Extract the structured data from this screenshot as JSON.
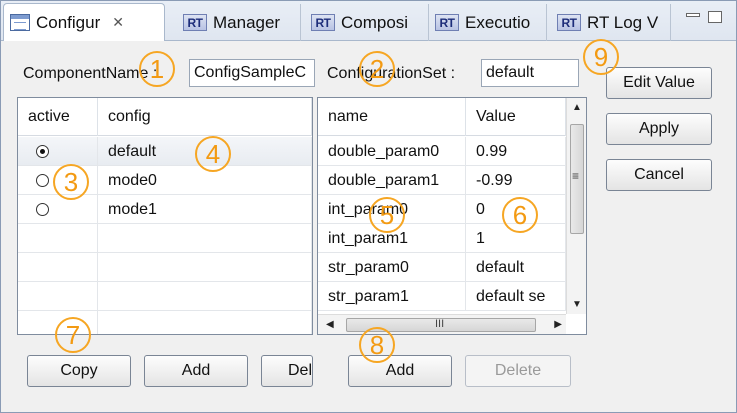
{
  "tabs": [
    {
      "label": "Configur",
      "icon": "view-list-icon"
    },
    {
      "label": "Manager",
      "icon": "rt-icon"
    },
    {
      "label": "Composi",
      "icon": "rt-icon"
    },
    {
      "label": "Executio",
      "icon": "rt-icon"
    },
    {
      "label": "RT Log V",
      "icon": "rt-icon"
    }
  ],
  "tab_close": "✕",
  "rt_badge": "RT",
  "component": {
    "label": "ComponentName :",
    "value": "ConfigSampleC"
  },
  "configset": {
    "label": "ConfigurationSet :",
    "value": "default"
  },
  "config_table": {
    "headers": [
      "active",
      "config"
    ],
    "rows": [
      {
        "active": true,
        "name": "default"
      },
      {
        "active": false,
        "name": "mode0"
      },
      {
        "active": false,
        "name": "mode1"
      }
    ]
  },
  "param_table": {
    "headers": [
      "name",
      "Value"
    ],
    "rows": [
      {
        "name": "double_param0",
        "value": "0.99"
      },
      {
        "name": "double_param1",
        "value": "-0.99"
      },
      {
        "name": "int_param0",
        "value": "0"
      },
      {
        "name": "int_param1",
        "value": "1"
      },
      {
        "name": "str_param0",
        "value": "default"
      },
      {
        "name": "str_param1",
        "value": "default se"
      }
    ],
    "scroll_grip": "≡",
    "hscroll_grip": "III"
  },
  "buttons": {
    "edit_value": "Edit Value",
    "apply": "Apply",
    "cancel": "Cancel",
    "copy": "Copy",
    "add_config": "Add",
    "delete_config": "Del",
    "add_param": "Add",
    "delete_param": "Delete"
  },
  "callouts": [
    "1",
    "2",
    "3",
    "4",
    "5",
    "6",
    "7",
    "8",
    "9"
  ],
  "colors": {
    "callout": "#f6a623"
  }
}
